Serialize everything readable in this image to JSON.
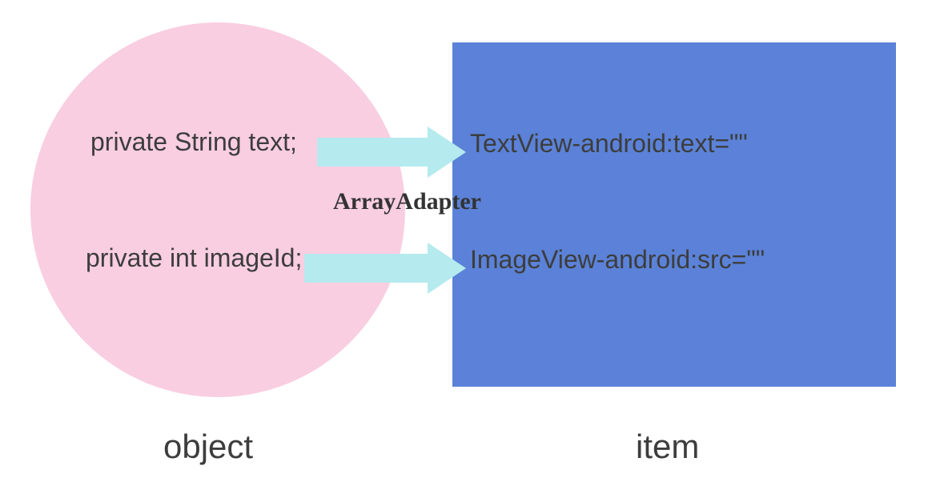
{
  "object": {
    "label": "object",
    "fields": [
      "private String text;",
      "private int imageId;"
    ]
  },
  "adapter": {
    "label": "ArrayAdapter"
  },
  "item": {
    "label": "item",
    "fields": [
      "TextView-android:text=\"\"",
      "ImageView-android:src=\"\""
    ]
  },
  "colors": {
    "circle": "#f9cee1",
    "rect": "#5b82d8",
    "arrow": "#b5eaee",
    "text": "#3d3d3d"
  }
}
